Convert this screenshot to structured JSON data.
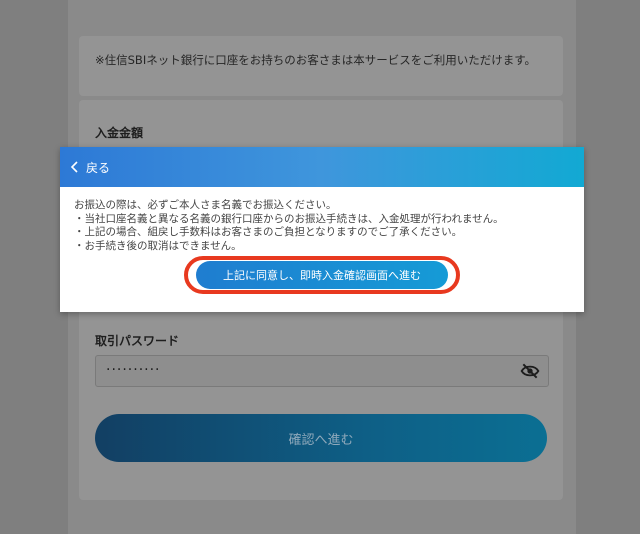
{
  "background": {
    "notice": "※住信SBIネット銀行に口座をお持ちのお客さまは本サービスをご利用いただけます。",
    "amount_label": "入金金額",
    "password_label": "取引パスワード",
    "password_value": "··········",
    "confirm_button": "確認へ進む"
  },
  "modal": {
    "back_label": "戻る",
    "lines": [
      "お振込の際は、必ずご本人さま名義でお振込ください。",
      "・当社口座名義と異なる名義の銀行口座からのお振込手続きは、入金処理が行われません。",
      "・上記の場合、組戻し手数料はお客さまのご負担となりますのでご了承ください。",
      "・お手続き後の取消はできません。"
    ],
    "agree_button": "上記に同意し、即時入金確認画面へ進む"
  },
  "colors": {
    "header_gradient_start": "#2d79d6",
    "header_gradient_end": "#12a9d3",
    "highlight_ring": "#e8391f"
  }
}
